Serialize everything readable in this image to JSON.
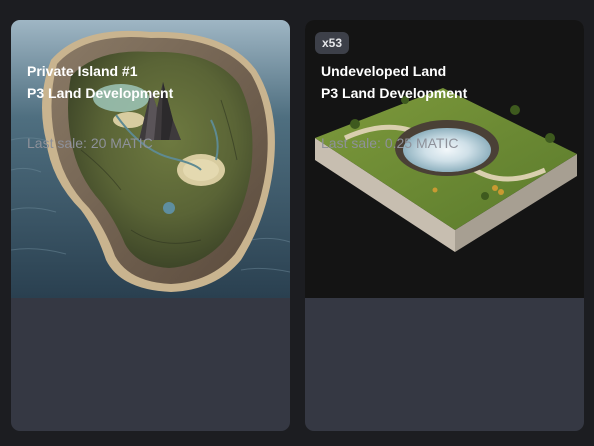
{
  "cards": [
    {
      "badge": "",
      "name": "Private Island #1",
      "collection": "P3 Land Development",
      "last_sale": "Last sale: 20 MATIC",
      "image": "island-artwork"
    },
    {
      "badge": "x53",
      "name": "Undeveloped Land",
      "collection": "P3 Land Development",
      "last_sale": "Last sale: 0.25 MATIC",
      "image": "land-block-artwork"
    }
  ],
  "colors": {
    "page_bg": "#1c1d21",
    "card_bg": "#353843",
    "badge_bg": "#3d4049",
    "title_text": "#ffffff",
    "muted_text": "#8e919a"
  }
}
